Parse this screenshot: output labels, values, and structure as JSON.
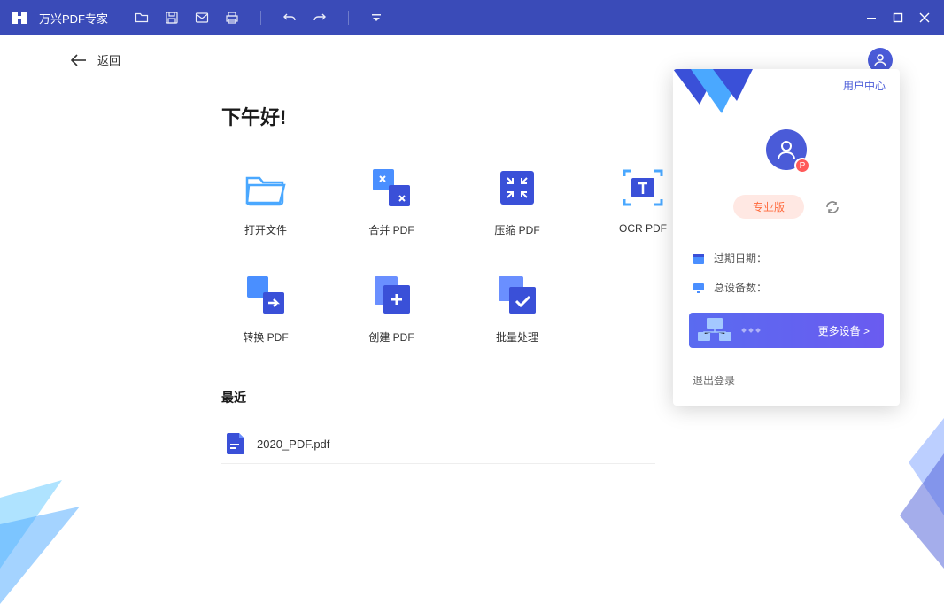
{
  "titlebar": {
    "app_name": "万兴PDF专家"
  },
  "back": {
    "label": "返回"
  },
  "greeting": "下午好!",
  "actions": [
    {
      "key": "open",
      "label": "打开文件"
    },
    {
      "key": "merge",
      "label": "合并 PDF"
    },
    {
      "key": "compress",
      "label": "压缩 PDF"
    },
    {
      "key": "ocr",
      "label": "OCR PDF"
    },
    {
      "key": "convert",
      "label": "转换 PDF"
    },
    {
      "key": "create",
      "label": "创建 PDF"
    },
    {
      "key": "batch",
      "label": "批量处理"
    }
  ],
  "recent": {
    "title": "最近",
    "items": [
      {
        "name": "2020_PDF.pdf"
      }
    ]
  },
  "panel": {
    "header_link": "用户中心",
    "avatar_badge": "P",
    "pro_label": "专业版",
    "expiry_label": "过期日期：",
    "devices_label": "总设备数：",
    "more_devices": "更多设备 >",
    "logout": "退出登录"
  }
}
